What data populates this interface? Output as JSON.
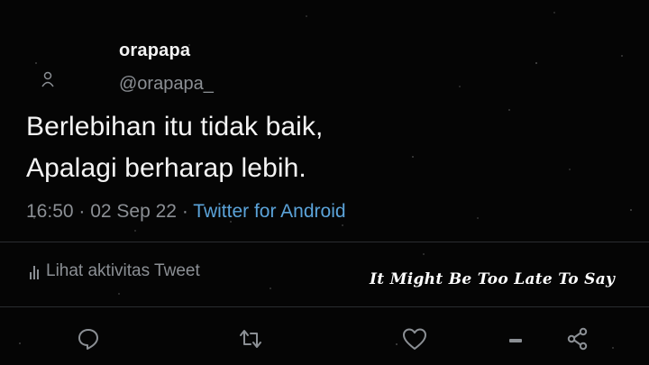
{
  "tweet": {
    "display_name": "orapapa",
    "handle": "@orapapa_",
    "text_line1": "Berlebihan itu tidak baik,",
    "text_line2": "Apalagi berharap lebih.",
    "time": "16:50",
    "date": "02 Sep 22",
    "separator": " · ",
    "source": "Twitter for Android"
  },
  "activity": {
    "label": "Lihat aktivitas Tweet",
    "icon": "bar-chart-icon"
  },
  "overlay": {
    "caption": "It Might Be Too Late To Say"
  },
  "actions": {
    "reply_icon": "reply-icon",
    "retweet_icon": "retweet-icon",
    "like_icon": "heart-icon",
    "bookmark_icon": "bookmark-icon",
    "share_icon": "share-icon"
  },
  "colors": {
    "background": "#050505",
    "primary_text": "#f4f4f4",
    "secondary_text": "#8b8f94",
    "link": "#5ba3d9"
  }
}
